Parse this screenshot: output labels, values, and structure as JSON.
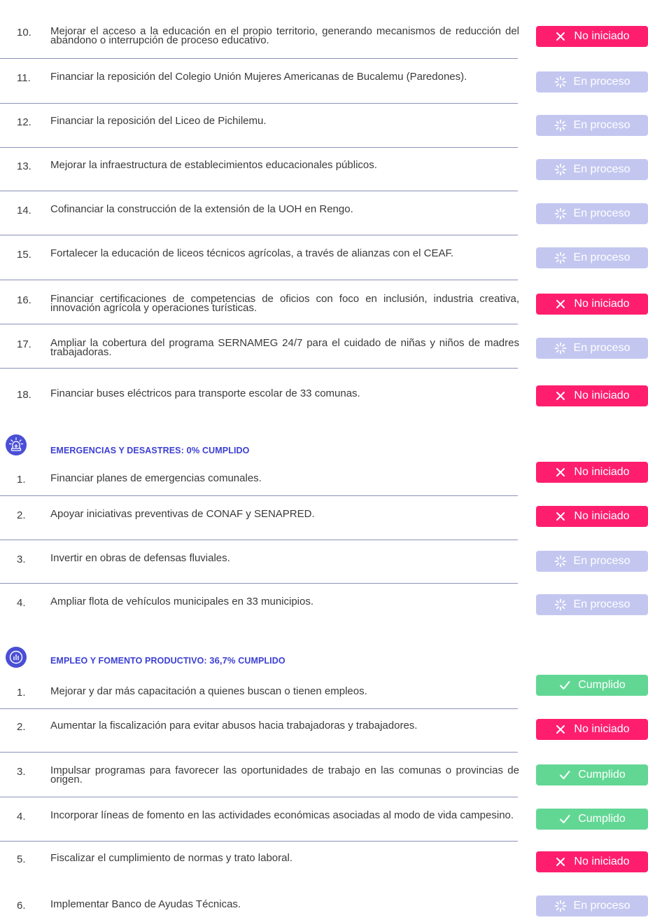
{
  "status_labels": {
    "no": "No iniciado",
    "proc": "En proceso",
    "done": "Cumplido"
  },
  "education": {
    "items": [
      {
        "num": "10.",
        "text": "Mejorar el acceso a la educación en el propio territorio, generando mecanismos de reducción del abandono o interrupción de proceso educativo.",
        "status": "no"
      },
      {
        "num": "11.",
        "text": "Financiar la reposición del Colegio Unión Mujeres Americanas de Bucalemu (Paredones).",
        "status": "proc"
      },
      {
        "num": "12.",
        "text": "Financiar la reposición del Liceo de Pichilemu.",
        "status": "proc"
      },
      {
        "num": "13.",
        "text": "Mejorar la infraestructura de establecimientos educacionales públicos.",
        "status": "proc"
      },
      {
        "num": "14.",
        "text": "Cofinanciar la construcción de la extensión de la UOH en Rengo.",
        "status": "proc"
      },
      {
        "num": "15.",
        "text": "Fortalecer la educación de liceos técnicos agrícolas, a través de alianzas con el CEAF.",
        "status": "proc"
      },
      {
        "num": "16.",
        "text": "Financiar certificaciones de competencias de oficios con foco en inclusión, industria creativa, innovación agrícola y operaciones turísticas.",
        "status": "no"
      },
      {
        "num": "17.",
        "text": "Ampliar la cobertura del programa SERNAMEG 24/7 para el cuidado de niñas y niños de madres trabajadoras.",
        "status": "proc"
      },
      {
        "num": "18.",
        "text": "Financiar buses eléctricos para transporte escolar de 33 comunas.",
        "status": "no"
      }
    ]
  },
  "emergencias": {
    "title_prefix": "EMERGENCIAS Y DESASTRES:",
    "percent": "0%",
    "title_suffix": "CUMPLIDO",
    "icon": "siren-icon",
    "items": [
      {
        "num": "1.",
        "text": "Financiar planes de emergencias comunales.",
        "status": "no"
      },
      {
        "num": "2.",
        "text": "Apoyar iniciativas preventivas de CONAF y SENAPRED.",
        "status": "no"
      },
      {
        "num": "3.",
        "text": "Invertir en obras de defensas fluviales.",
        "status": "proc"
      },
      {
        "num": "4.",
        "text": "Ampliar flota de vehículos municipales en 33 municipios.",
        "status": "proc"
      }
    ]
  },
  "empleo": {
    "title_prefix": "EMPLEO Y FOMENTO PRODUCTIVO:",
    "percent": "36,7%",
    "title_suffix": "CUMPLIDO",
    "icon": "bar-chart-icon",
    "items": [
      {
        "num": "1.",
        "text": "Mejorar y dar más capacitación a quienes buscan o tienen empleos.",
        "status": "done"
      },
      {
        "num": "2.",
        "text": "Aumentar la fiscalización para evitar abusos hacia trabajadoras y trabajadores.",
        "status": "no"
      },
      {
        "num": "3.",
        "text": "Impulsar programas para favorecer las oportunidades de trabajo en las comunas o provincias de origen.",
        "status": "done"
      },
      {
        "num": "4.",
        "text": "Incorporar líneas de fomento en las actividades económicas asociadas al modo de vida campesino.",
        "status": "done"
      },
      {
        "num": "5.",
        "text": "Fiscalizar el cumplimiento de normas y trato laboral.",
        "status": "no"
      },
      {
        "num": "6.",
        "text": "Implementar Banco de Ayudas Técnicas.",
        "status": "proc"
      }
    ]
  },
  "colors": {
    "no": "#ff1e6e",
    "proc": "#c3c7f0",
    "done": "#62d794",
    "accent": "#3b3fd3",
    "divider": "#8b93b8"
  }
}
